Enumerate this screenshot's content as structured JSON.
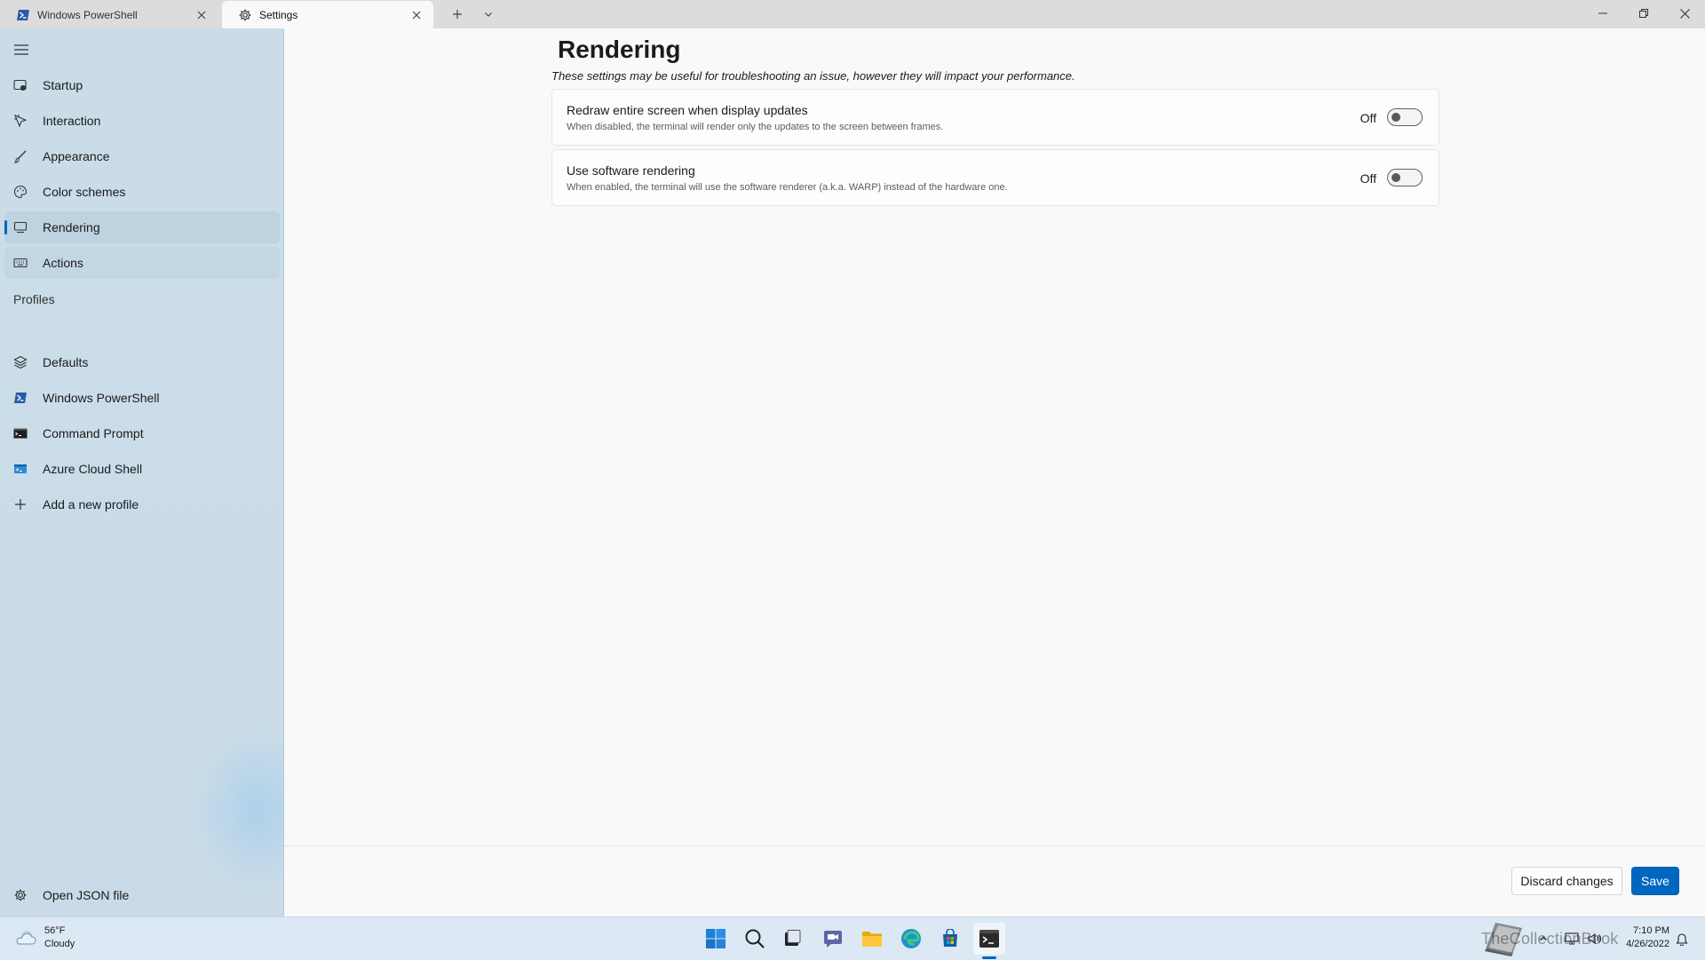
{
  "tabs": [
    {
      "label": "Windows PowerShell",
      "icon": "powershell-icon",
      "active": false
    },
    {
      "label": "Settings",
      "icon": "gear-icon",
      "active": true
    }
  ],
  "sidebar": {
    "items": [
      {
        "label": "Startup",
        "icon": "startup-icon"
      },
      {
        "label": "Interaction",
        "icon": "interaction-icon"
      },
      {
        "label": "Appearance",
        "icon": "paintbrush-icon"
      },
      {
        "label": "Color schemes",
        "icon": "color-palette-icon"
      },
      {
        "label": "Rendering",
        "icon": "monitor-icon",
        "selected": true
      },
      {
        "label": "Actions",
        "icon": "keyboard-icon"
      }
    ],
    "profiles_header": "Profiles",
    "profiles": [
      {
        "label": "Defaults",
        "icon": "layers-icon"
      },
      {
        "label": "Windows PowerShell",
        "icon": "powershell-icon"
      },
      {
        "label": "Command Prompt",
        "icon": "command-prompt-icon"
      },
      {
        "label": "Azure Cloud Shell",
        "icon": "azure-icon"
      },
      {
        "label": "Add a new profile",
        "icon": "plus-icon"
      }
    ],
    "open_json": "Open JSON file"
  },
  "main": {
    "title": "Rendering",
    "description": "These settings may be useful for troubleshooting an issue, however they will impact your performance.",
    "settings": [
      {
        "title": "Redraw entire screen when display updates",
        "description": "When disabled, the terminal will render only the updates to the screen between frames.",
        "state": "Off"
      },
      {
        "title": "Use software rendering",
        "description": "When enabled, the terminal will use the software renderer (a.k.a. WARP) instead of the hardware one.",
        "state": "Off"
      }
    ],
    "discard_label": "Discard changes",
    "save_label": "Save"
  },
  "taskbar": {
    "temperature": "56°F",
    "condition": "Cloudy",
    "time": "7:10 PM",
    "date": "4/26/2022",
    "watermark": "TheCollectionBook",
    "accent": "#0067c0"
  }
}
